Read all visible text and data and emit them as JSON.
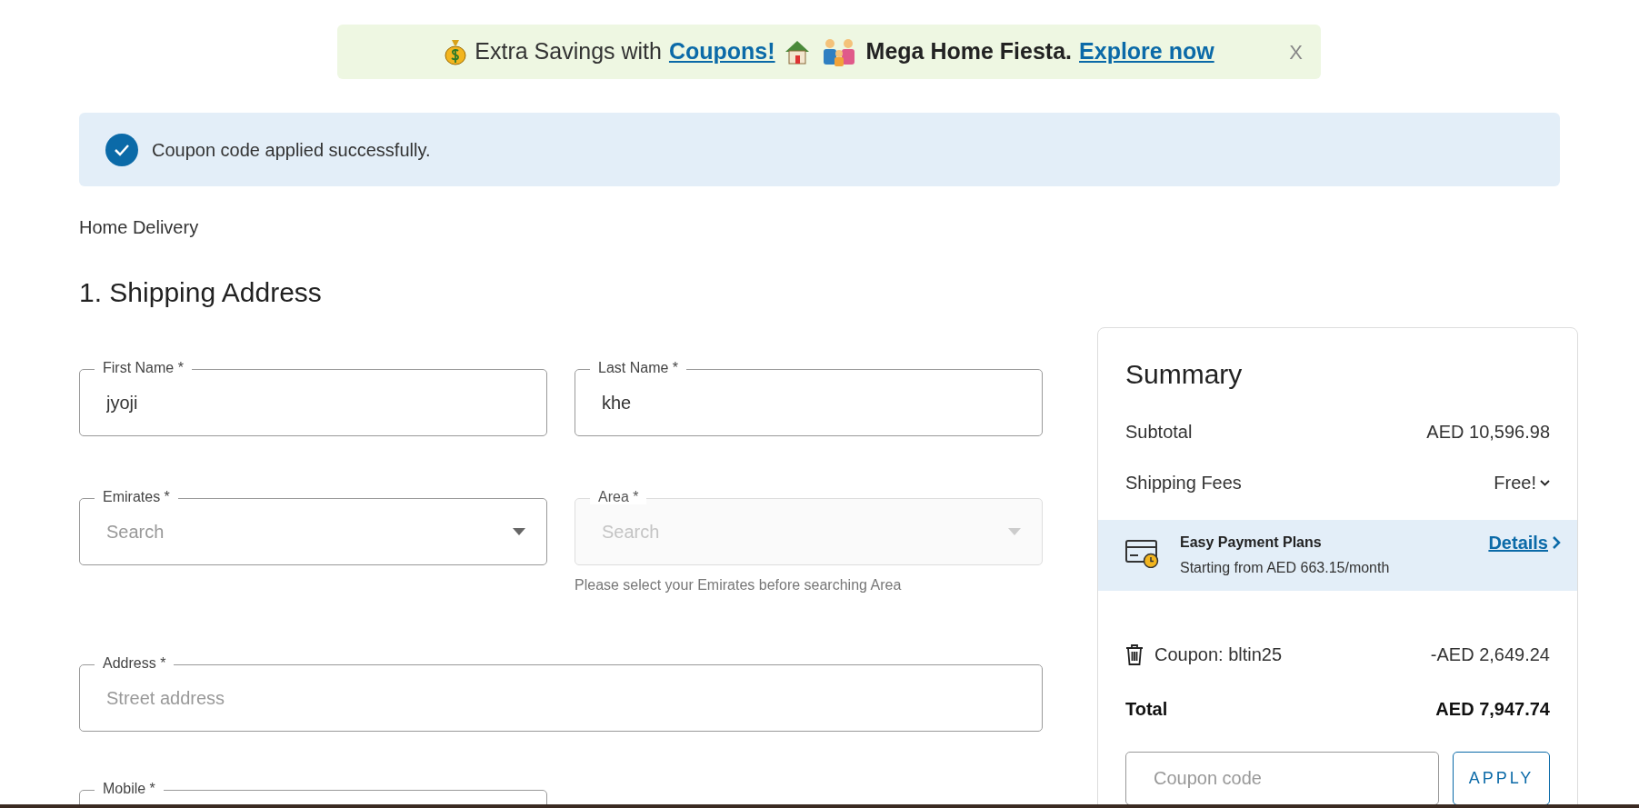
{
  "promo_banner": {
    "text_1": "Extra Savings with",
    "link_1": "Coupons!",
    "text_2": "Mega Home Fiesta.",
    "link_2": "Explore now",
    "close": "X"
  },
  "alert": {
    "message": "Coupon code applied successfully."
  },
  "delivery_method": "Home Delivery",
  "section_title": "1. Shipping Address",
  "form_rows": [
    [
      {
        "kind": "text",
        "label": "First Name *",
        "value": "jyoji",
        "disabled": false
      },
      {
        "kind": "text",
        "label": "Last Name *",
        "value": "khe",
        "disabled": false
      }
    ],
    [
      {
        "kind": "select",
        "label": "Emirates *",
        "placeholder": "Search",
        "disabled": false
      },
      {
        "kind": "select",
        "label": "Area *",
        "placeholder": "Search",
        "disabled": true,
        "helper": "Please select your Emirates before searching Area"
      }
    ],
    [
      {
        "kind": "wide",
        "label": "Address *",
        "placeholder": "Street address",
        "disabled": false
      }
    ],
    [
      {
        "kind": "text",
        "label": "Mobile *",
        "disabled": false
      }
    ]
  ],
  "summary": {
    "title": "Summary",
    "lines": [
      {
        "label": "Subtotal",
        "value": "AED 10,596.98",
        "kind": "plain"
      },
      {
        "label": "Shipping Fees",
        "value": "Free!",
        "kind": "dropdown"
      }
    ],
    "payment_plan": {
      "title": "Easy Payment Plans",
      "subtitle": "Starting from AED 663.15/month",
      "link": "Details"
    },
    "coupon": {
      "label": "Coupon: bltin25",
      "value": "-AED 2,649.24"
    },
    "total": {
      "label": "Total",
      "value": "AED 7,947.74"
    },
    "coupon_field": {
      "placeholder": "Coupon code"
    },
    "apply_button": "APPLY"
  }
}
